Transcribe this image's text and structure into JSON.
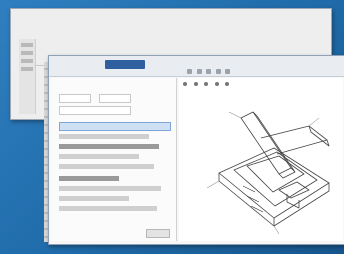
{
  "back_window": {
    "title": "",
    "subtitle": ""
  },
  "front_window": {
    "title": "",
    "tabs": [
      {
        "label": "",
        "active": false
      },
      {
        "label": "",
        "active": true
      },
      {
        "label": "",
        "active": false
      }
    ],
    "panel": {
      "header": "",
      "footer_label": "",
      "button_label": ""
    },
    "canvas": {
      "caption": "",
      "scale_label": ""
    }
  },
  "colors": {
    "desktop": "#2f7fc0",
    "ribbon_active": "#2f5f9e",
    "selection": "#cfe0f5"
  },
  "icons": [
    "toolbar-icon",
    "tool-icon"
  ]
}
